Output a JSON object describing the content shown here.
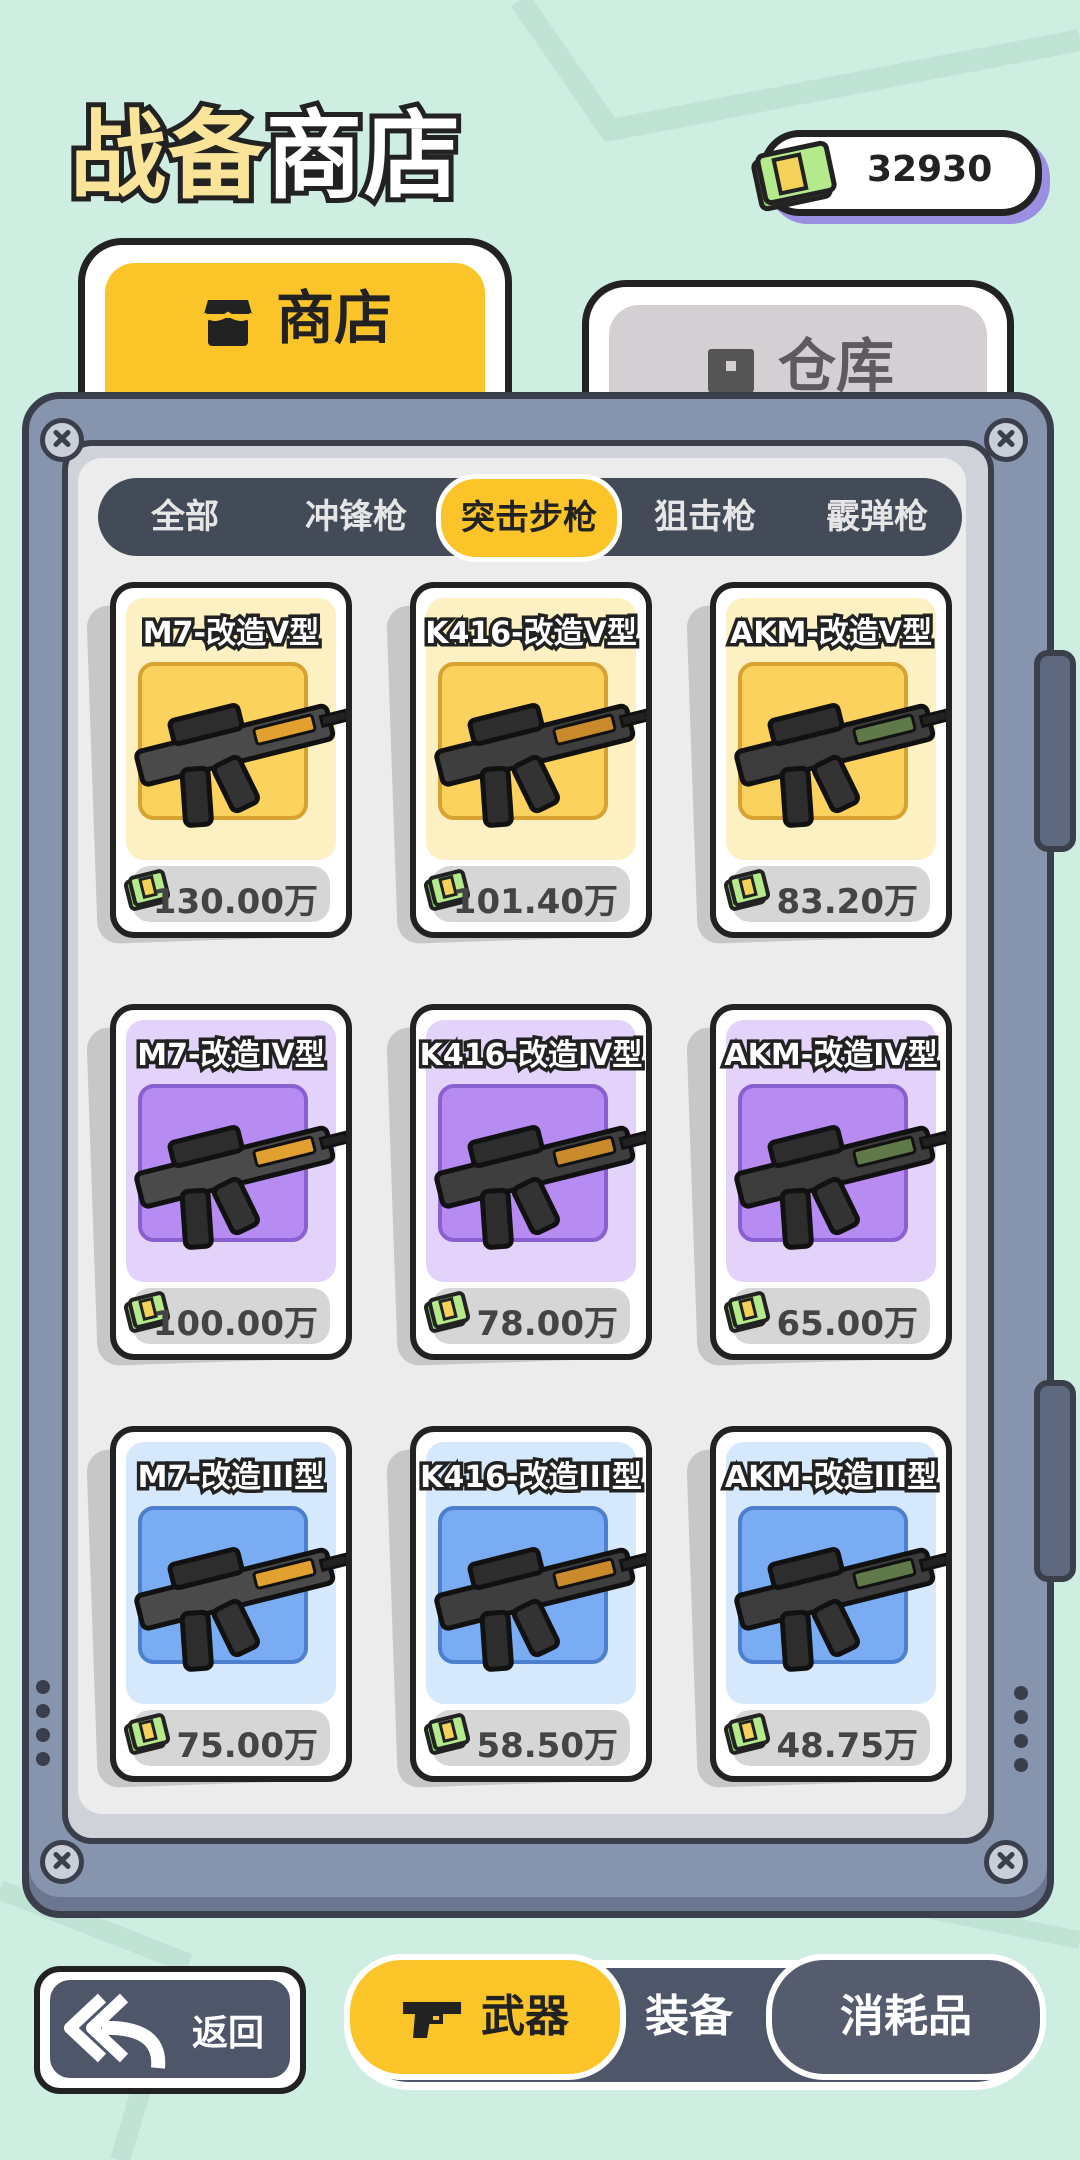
{
  "header": {
    "title_part1": "战备",
    "title_part2": "商店"
  },
  "currency": {
    "value": "32930",
    "icon": "cash-icon"
  },
  "tabs": {
    "shop": "商店",
    "warehouse": "仓库",
    "shop_icon": "store-icon",
    "warehouse_icon": "box-icon"
  },
  "categories": [
    {
      "label": "全部",
      "active": false
    },
    {
      "label": "冲锋枪",
      "active": false
    },
    {
      "label": "突击步枪",
      "active": true
    },
    {
      "label": "狙击枪",
      "active": false
    },
    {
      "label": "霰弹枪",
      "active": false
    }
  ],
  "items": [
    {
      "name": "M7-改造V型",
      "price": "130.00万",
      "tier": "V",
      "color": "#fbd25d",
      "border": "#d8a230"
    },
    {
      "name": "K416-改造V型",
      "price": "101.40万",
      "tier": "V",
      "color": "#fbd25d",
      "border": "#d8a230"
    },
    {
      "name": "AKM-改造V型",
      "price": "83.20万",
      "tier": "V",
      "color": "#fbd25d",
      "border": "#d8a230"
    },
    {
      "name": "M7-改造IV型",
      "price": "100.00万",
      "tier": "IV",
      "color": "#b68bf2",
      "border": "#8a5fd0"
    },
    {
      "name": "K416-改造IV型",
      "price": "78.00万",
      "tier": "IV",
      "color": "#b68bf2",
      "border": "#8a5fd0"
    },
    {
      "name": "AKM-改造IV型",
      "price": "65.00万",
      "tier": "IV",
      "color": "#b68bf2",
      "border": "#8a5fd0"
    },
    {
      "name": "M7-改造III型",
      "price": "75.00万",
      "tier": "III",
      "color": "#79acf2",
      "border": "#4d7fcf"
    },
    {
      "name": "K416-改造III型",
      "price": "58.50万",
      "tier": "III",
      "color": "#79acf2",
      "border": "#4d7fcf"
    },
    {
      "name": "AKM-改造III型",
      "price": "48.75万",
      "tier": "III",
      "color": "#79acf2",
      "border": "#4d7fcf"
    }
  ],
  "bottom": {
    "back_label": "返回",
    "back_icon": "back-arrow-icon",
    "weapons": "武器",
    "weapons_icon": "pistol-icon",
    "gear": "装备",
    "consumables": "消耗品"
  },
  "colors": {
    "accent": "#fbc52a",
    "panel": "#8794ad",
    "background": "#cfeee2"
  }
}
